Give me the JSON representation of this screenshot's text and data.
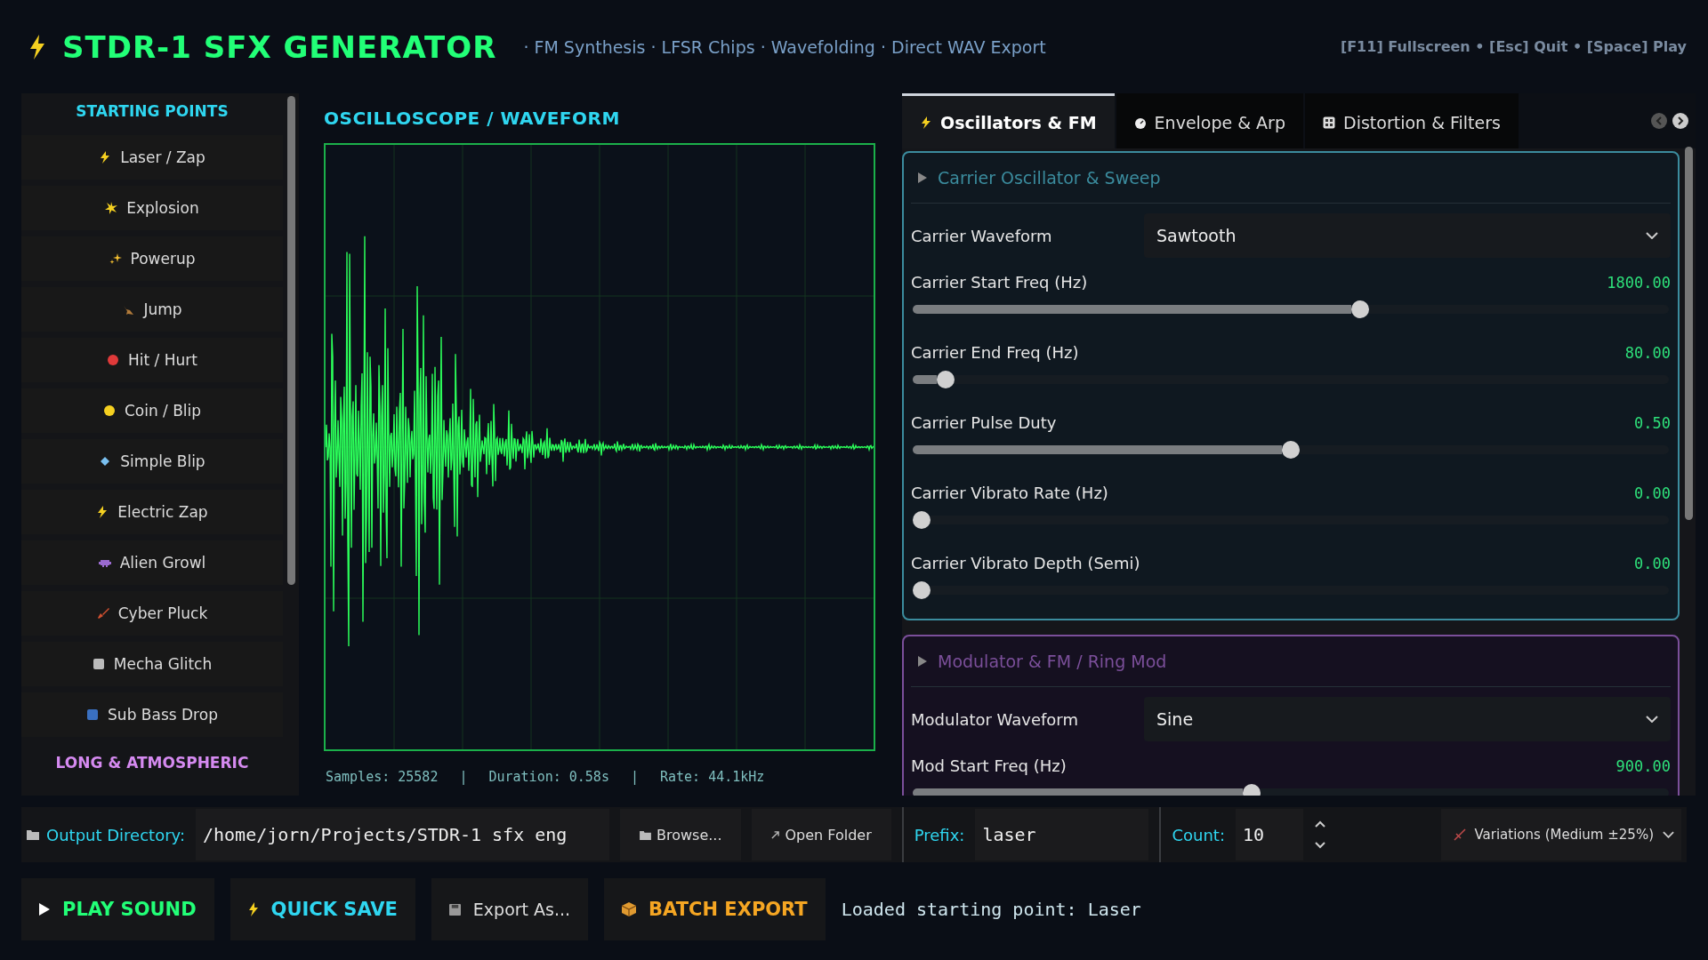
{
  "header": {
    "title": "STDR-1 SFX GENERATOR",
    "subtitle": "· FM Synthesis · LFSR Chips · Wavefolding · Direct WAV Export",
    "shortcuts": "[F11] Fullscreen • [Esc] Quit • [Space] Play"
  },
  "sidebar": {
    "heading": "STARTING POINTS",
    "items": [
      {
        "label": "Laser / Zap"
      },
      {
        "label": "Explosion"
      },
      {
        "label": "Powerup"
      },
      {
        "label": "Jump"
      },
      {
        "label": "Hit / Hurt"
      },
      {
        "label": "Coin / Blip"
      },
      {
        "label": "Simple Blip"
      },
      {
        "label": "Electric Zap"
      },
      {
        "label": "Alien Growl"
      },
      {
        "label": "Cyber Pluck"
      },
      {
        "label": "Mecha Glitch"
      },
      {
        "label": "Sub Bass Drop"
      }
    ],
    "next_heading": "LONG & ATMOSPHERIC"
  },
  "oscilloscope": {
    "title": "OSCILLOSCOPE / WAVEFORM",
    "samples": "Samples: 25582",
    "duration": "Duration: 0.58s",
    "rate": "Rate: 44.1kHz",
    "separator": "|"
  },
  "tabs": [
    {
      "label": "Oscillators & FM",
      "selected": true
    },
    {
      "label": "Envelope & Arp",
      "selected": false
    },
    {
      "label": "Distortion & Filters",
      "selected": false
    }
  ],
  "sections": [
    {
      "title": "Carrier Oscillator & Sweep",
      "color": "#3b8c9e",
      "controls": [
        {
          "kind": "select",
          "label": "Carrier Waveform",
          "value": "Sawtooth"
        },
        {
          "kind": "slider",
          "label": "Carrier Start Freq (Hz)",
          "reading": "1800.00",
          "level": 0.594
        },
        {
          "kind": "slider",
          "label": "Carrier End Freq (Hz)",
          "reading": "80.00",
          "level": 0.033
        },
        {
          "kind": "slider",
          "label": "Carrier Pulse Duty",
          "reading": "0.50",
          "level": 0.5
        },
        {
          "kind": "slider",
          "label": "Carrier Vibrato Rate (Hz)",
          "reading": "0.00",
          "level": 0
        },
        {
          "kind": "slider",
          "label": "Carrier Vibrato Depth (Semi)",
          "reading": "0.00",
          "level": 0
        }
      ]
    },
    {
      "title": "Modulator & FM / Ring Mod",
      "color": "#7b4f9a",
      "controls": [
        {
          "kind": "select",
          "label": "Modulator Waveform",
          "value": "Sine"
        },
        {
          "kind": "slider",
          "label": "Mod Start Freq (Hz)",
          "reading": "900.00",
          "level": 0.447
        }
      ]
    }
  ],
  "output": {
    "directory_label": "Output Directory:",
    "directory": "/home/jorn/Projects/STDR-1 sfx eng",
    "browse": "Browse...",
    "open_folder": "Open Folder",
    "prefix_label": "Prefix:",
    "prefix": "laser",
    "count_label": "Count:",
    "count": "10",
    "variations": "Variations (Medium ±25%)"
  },
  "actions": {
    "play": "PLAY SOUND",
    "quick_save": "QUICK SAVE",
    "export_as": "Export As...",
    "batch_export": "BATCH EXPORT",
    "status": "Loaded starting point: Laser"
  }
}
